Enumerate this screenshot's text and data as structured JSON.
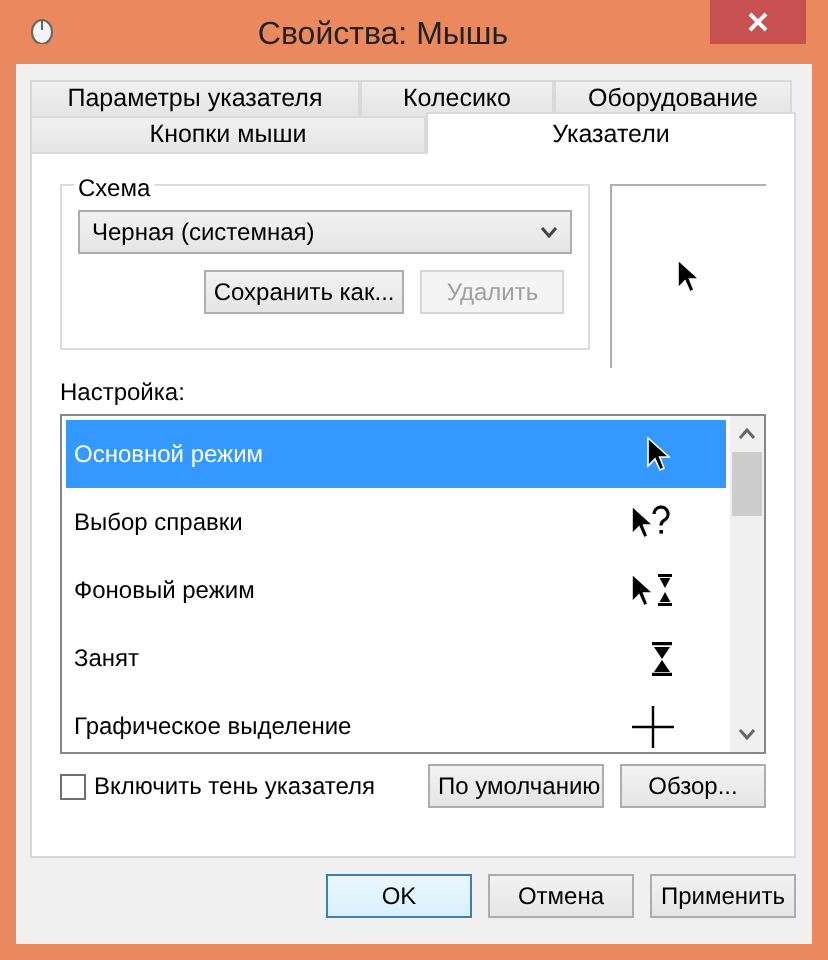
{
  "window": {
    "title": "Свойства: Мышь"
  },
  "tab_rows": [
    [
      {
        "label": "Параметры указателя",
        "selected": false
      },
      {
        "label": "Колесико",
        "selected": false
      },
      {
        "label": "Оборудование",
        "selected": false
      }
    ],
    [
      {
        "label": "Кнопки мыши",
        "selected": false
      },
      {
        "label": "Указатели",
        "selected": true
      }
    ]
  ],
  "scheme": {
    "label": "Схема",
    "value": "Черная (системная)",
    "buttons": [
      {
        "label": "Сохранить как...",
        "disabled": false
      },
      {
        "label": "Удалить",
        "disabled": true
      }
    ]
  },
  "customize": {
    "label": "Настройка:",
    "items": [
      {
        "name": "Основной режим",
        "kind": "arrow",
        "selected": true
      },
      {
        "name": "Выбор справки",
        "kind": "help",
        "selected": false
      },
      {
        "name": "Фоновый режим",
        "kind": "working",
        "selected": false
      },
      {
        "name": "Занят",
        "kind": "busy",
        "selected": false
      },
      {
        "name": "Графическое выделение",
        "kind": "cross",
        "selected": false
      }
    ]
  },
  "shadow": {
    "label": "Включить тень указателя",
    "checked": false
  },
  "list_buttons": [
    "По умолчанию",
    "Обзор..."
  ],
  "dialog_buttons": [
    {
      "label": "OK",
      "default": true
    },
    {
      "label": "Отмена",
      "default": false
    },
    {
      "label": "Применить",
      "default": false
    }
  ]
}
